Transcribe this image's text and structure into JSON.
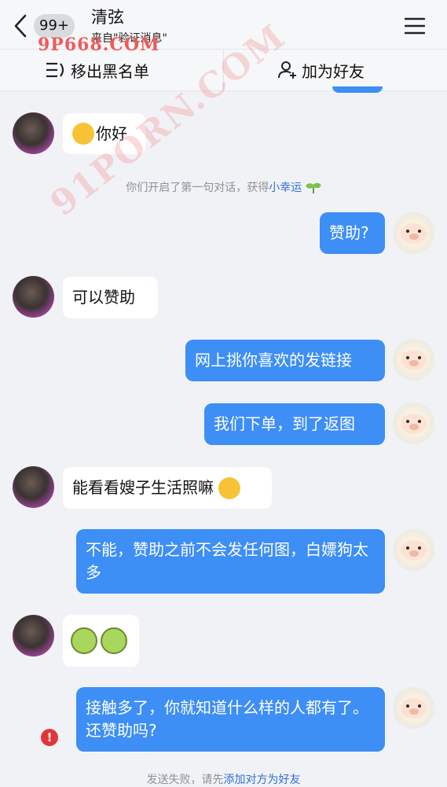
{
  "header": {
    "badge": "99+",
    "title": "清弦",
    "subtitle": "来自\"验证消息\""
  },
  "actions": {
    "remove_blacklist": "移出黑名单",
    "add_friend": "加为好友"
  },
  "messages": [
    {
      "side": "other",
      "text": "你好",
      "emoji": "blush-emoji"
    },
    {
      "side": "self",
      "text": "赞助?"
    },
    {
      "side": "other",
      "text": "可以赞助"
    },
    {
      "side": "self",
      "text": "网上挑你喜欢的发链接"
    },
    {
      "side": "self",
      "text": "我们下单，到了返图"
    },
    {
      "side": "other",
      "text": "能看看嫂子生活照嘛",
      "emoji": "grin-emoji"
    },
    {
      "side": "self",
      "text": "不能，赞助之前不会发任何图，白嫖狗太多"
    },
    {
      "side": "other",
      "text": "",
      "emoji": "green-frown-emoji x2"
    },
    {
      "side": "self",
      "text": "接触多了，你就知道什么样的人都有了。还赞助吗?",
      "status": "failed"
    }
  ],
  "system": {
    "first_chat_prefix": "你们开启了第一句对话，获得",
    "first_chat_link": "小幸运",
    "send_failed_prefix": "发送失败，请先",
    "send_failed_link": "添加对方为好友"
  },
  "watermarks": {
    "top": "9P668.COM",
    "diagonal": "91PORN.COM"
  },
  "colors": {
    "self_bubble": "#3d8ef5",
    "other_bubble": "#ffffff",
    "background": "#f1f2f6",
    "link": "#2f6fd6",
    "error": "#e0363a"
  }
}
